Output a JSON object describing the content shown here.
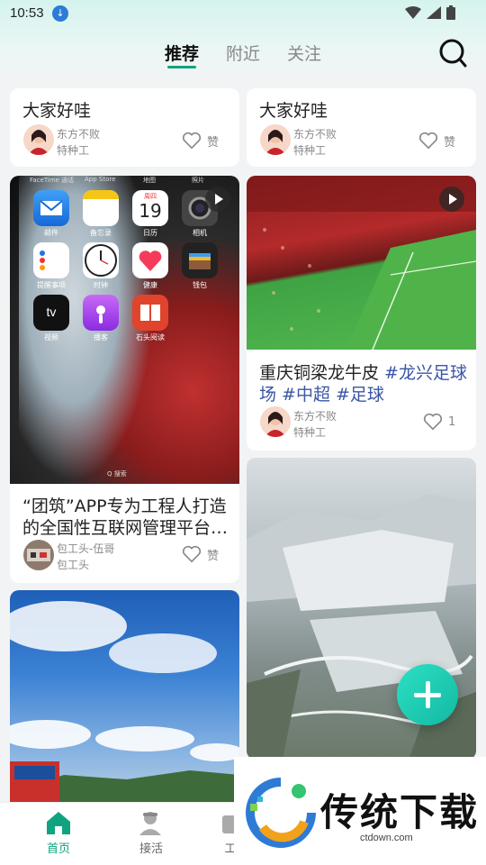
{
  "status_bar": {
    "time": "10:53"
  },
  "tabs": [
    {
      "label": "推荐"
    },
    {
      "label": "附近"
    },
    {
      "label": "关注"
    }
  ],
  "cards": {
    "c1": {
      "title": "大家好哇",
      "author": "东方不败",
      "role": "特种工",
      "like": "赞"
    },
    "c2": {
      "title": "大家好哇",
      "author": "东方不败",
      "role": "特种工",
      "like": "赞"
    },
    "c3": {
      "title": "“团筑”APP专为工程人打造的全国性互联网管理平台…",
      "author": "包工头-伍哥",
      "role": "包工头",
      "like": "赞",
      "phone_apps": [
        "邮件",
        "备忘录",
        "日历",
        "相机",
        "提醒事项",
        "时钟",
        "健康",
        "钱包",
        "视频",
        "播客",
        "石头阅读"
      ],
      "calendar_day": "周四",
      "calendar_date": "19",
      "top_labels": [
        "FaceTime 通话",
        "App Store",
        "地图",
        "照片"
      ],
      "search_hint": "Q 搜索"
    },
    "c4": {
      "title_plain": "重庆铜梁龙牛皮 ",
      "title_tags": "#龙兴足球场 #中超 #足球",
      "author": "东方不败",
      "role": "特种工",
      "like_count": "1"
    },
    "c5": {},
    "c6": {}
  },
  "bottom_nav": [
    {
      "label": "首页"
    },
    {
      "label": "接活"
    },
    {
      "label": "工"
    }
  ],
  "watermark": {
    "title": "传统下载",
    "url": "ctdown.com"
  },
  "colors": {
    "accent": "#10a37f",
    "hashtag": "#3a56a6"
  }
}
